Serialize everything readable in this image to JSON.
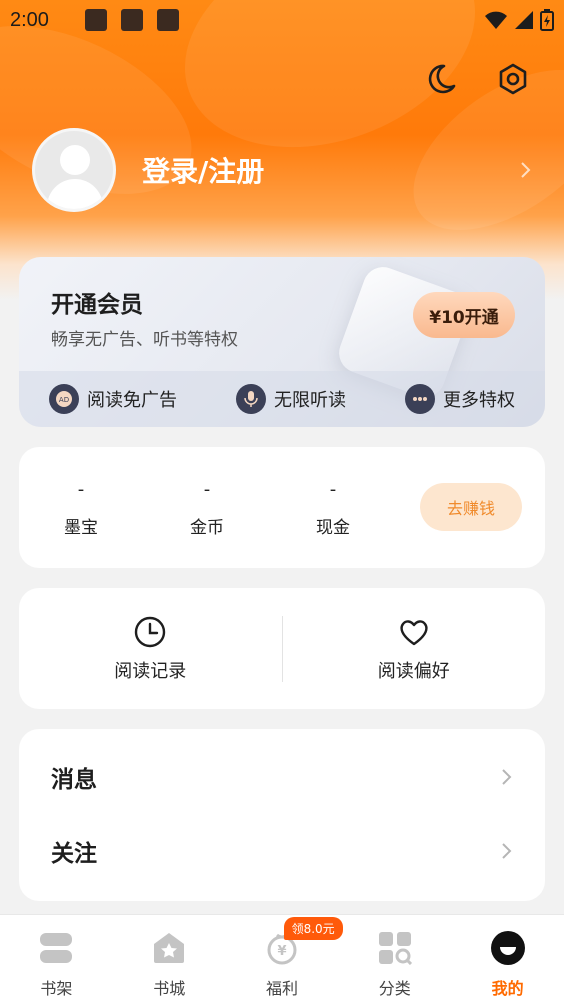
{
  "status_bar": {
    "time": "2:00"
  },
  "header": {
    "login_text": "登录/注册",
    "icons": [
      "moon-icon",
      "settings-hexagon-icon"
    ]
  },
  "vip": {
    "title": "开通会员",
    "subtitle": "畅享无广告、听书等特权",
    "button": "¥10开通",
    "perks": [
      {
        "label": "阅读免广告",
        "icon": "ad-free-icon"
      },
      {
        "label": "无限听读",
        "icon": "microphone-icon"
      },
      {
        "label": "更多特权",
        "icon": "more-dots-icon"
      }
    ]
  },
  "wallet": {
    "items": [
      {
        "value": "-",
        "label": "墨宝"
      },
      {
        "value": "-",
        "label": "金币"
      },
      {
        "value": "-",
        "label": "现金"
      }
    ],
    "earn_button": "去赚钱"
  },
  "reading": {
    "history": "阅读记录",
    "preference": "阅读偏好"
  },
  "menu": {
    "messages": "消息",
    "follow": "关注"
  },
  "tabbar": {
    "tabs": [
      {
        "label": "书架",
        "icon": "bookshelf-icon"
      },
      {
        "label": "书城",
        "icon": "bookstore-icon"
      },
      {
        "label": "福利",
        "icon": "welfare-icon",
        "badge": "领8.0元"
      },
      {
        "label": "分类",
        "icon": "category-icon"
      },
      {
        "label": "我的",
        "icon": "profile-icon",
        "active": true
      }
    ]
  },
  "colors": {
    "brand_orange": "#ff7a0a",
    "active_tab": "#ff6a00",
    "earn_text": "#f08a2b"
  }
}
